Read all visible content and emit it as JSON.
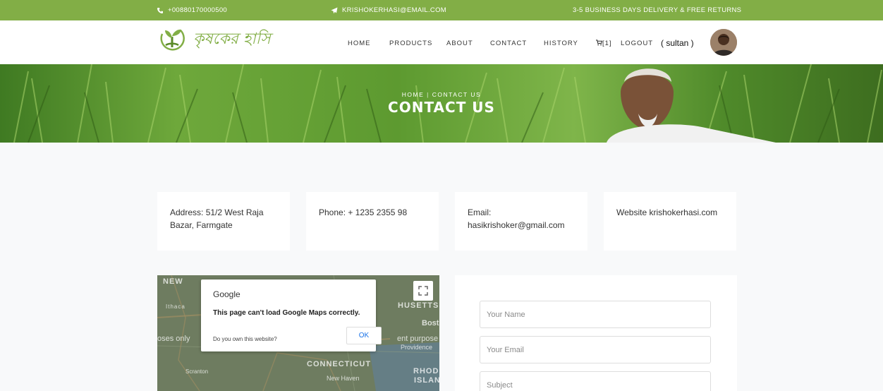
{
  "topbar": {
    "phone": "+00880170000500",
    "email": "KRISHOKERHASI@EMAIL.COM",
    "delivery": "3-5 BUSINESS DAYS DELIVERY & FREE RETURNS"
  },
  "nav": {
    "brand": "কৃষকের হাসি",
    "items": [
      "HOME",
      "PRODUCTS",
      "ABOUT",
      "CONTACT",
      "HISTORY",
      "[1]",
      "LOGOUT"
    ],
    "user": "( sultan )"
  },
  "hero": {
    "crumb_home": "HOME",
    "crumb_current": "CONTACT US",
    "title": "CONTACT US"
  },
  "info": {
    "address": "Address: 51/2 West Raja Bazar, Farmgate",
    "phone": "Phone: + 1235 2355 98",
    "email_label": "Email:",
    "email": "hasikrishoker@gmail.com",
    "website": "Website krishokerhasi.com"
  },
  "map": {
    "labels": [
      "NEW",
      "Ithaca",
      "oses only",
      "HUSETTS",
      "Bost",
      "ent purpose",
      "Providence",
      "CONNECTICUT",
      "RHODE",
      "ISLAND",
      "New Haven",
      "Scranton"
    ],
    "dialog_title": "Google",
    "dialog_message": "This page can't load Google Maps correctly.",
    "dialog_question": "Do you own this website?",
    "dialog_ok": "OK"
  },
  "form": {
    "name_placeholder": "Your Name",
    "email_placeholder": "Your Email",
    "subject_placeholder": "Subject"
  },
  "colors": {
    "brand_green": "#82ae46"
  }
}
